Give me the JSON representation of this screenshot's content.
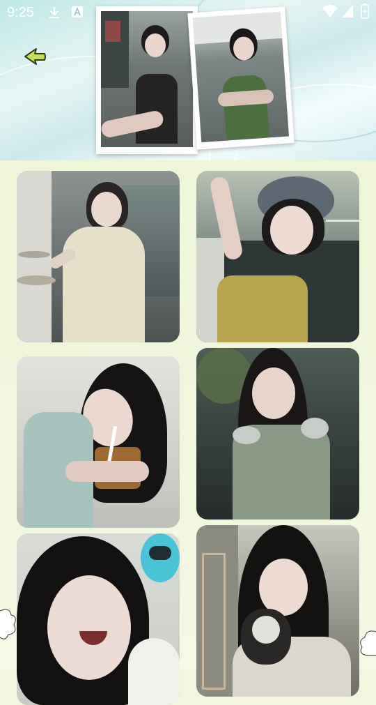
{
  "status_bar": {
    "time": "9:25",
    "left_icons": [
      "download-icon",
      "a-icon"
    ],
    "right_icons": [
      "wifi-icon",
      "signal-icon",
      "battery-icon"
    ]
  },
  "header": {
    "back_icon": "back-arrow-icon",
    "accent_color": "#b8d94a",
    "photos": [
      "polaroid-photo-1",
      "polaroid-photo-2"
    ]
  },
  "gallery": {
    "items": [
      {
        "name": "gallery-photo-1"
      },
      {
        "name": "gallery-photo-2"
      },
      {
        "name": "gallery-photo-3"
      },
      {
        "name": "gallery-photo-4"
      },
      {
        "name": "gallery-photo-5"
      },
      {
        "name": "gallery-photo-6"
      }
    ]
  }
}
